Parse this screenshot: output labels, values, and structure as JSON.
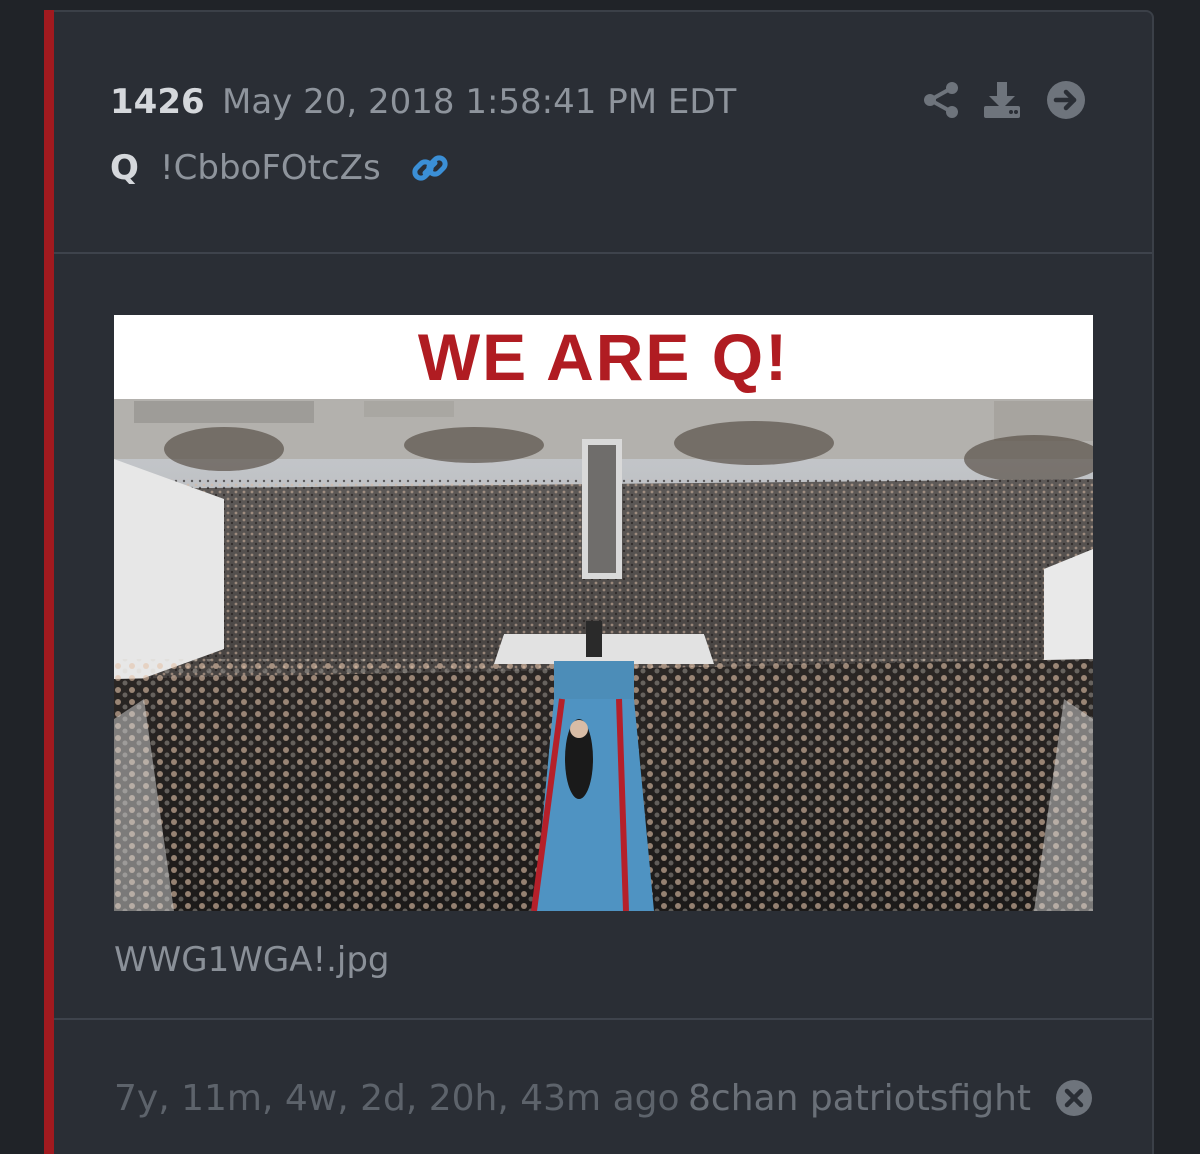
{
  "post": {
    "number": "1426",
    "date": "May 20, 2018 1:58:41 PM EDT",
    "author": "Q",
    "tripcode": "!CbboFOtcZs"
  },
  "header_icons": [
    "share-icon",
    "download-icon",
    "arrow-right-circle-icon",
    "link-icon"
  ],
  "image": {
    "banner_text": "WE ARE Q!",
    "file_name": "WWG1WGA!.jpg"
  },
  "footer": {
    "elapsed": "7y, 11m, 4w, 2d, 20h, 43m ago",
    "source": "8chan patriotsfight"
  },
  "colors": {
    "accent": "#a11a1f",
    "link_blue": "#3b8fd6",
    "banner_red": "#b01c22",
    "background": "#202328",
    "card": "#2a2e35"
  }
}
